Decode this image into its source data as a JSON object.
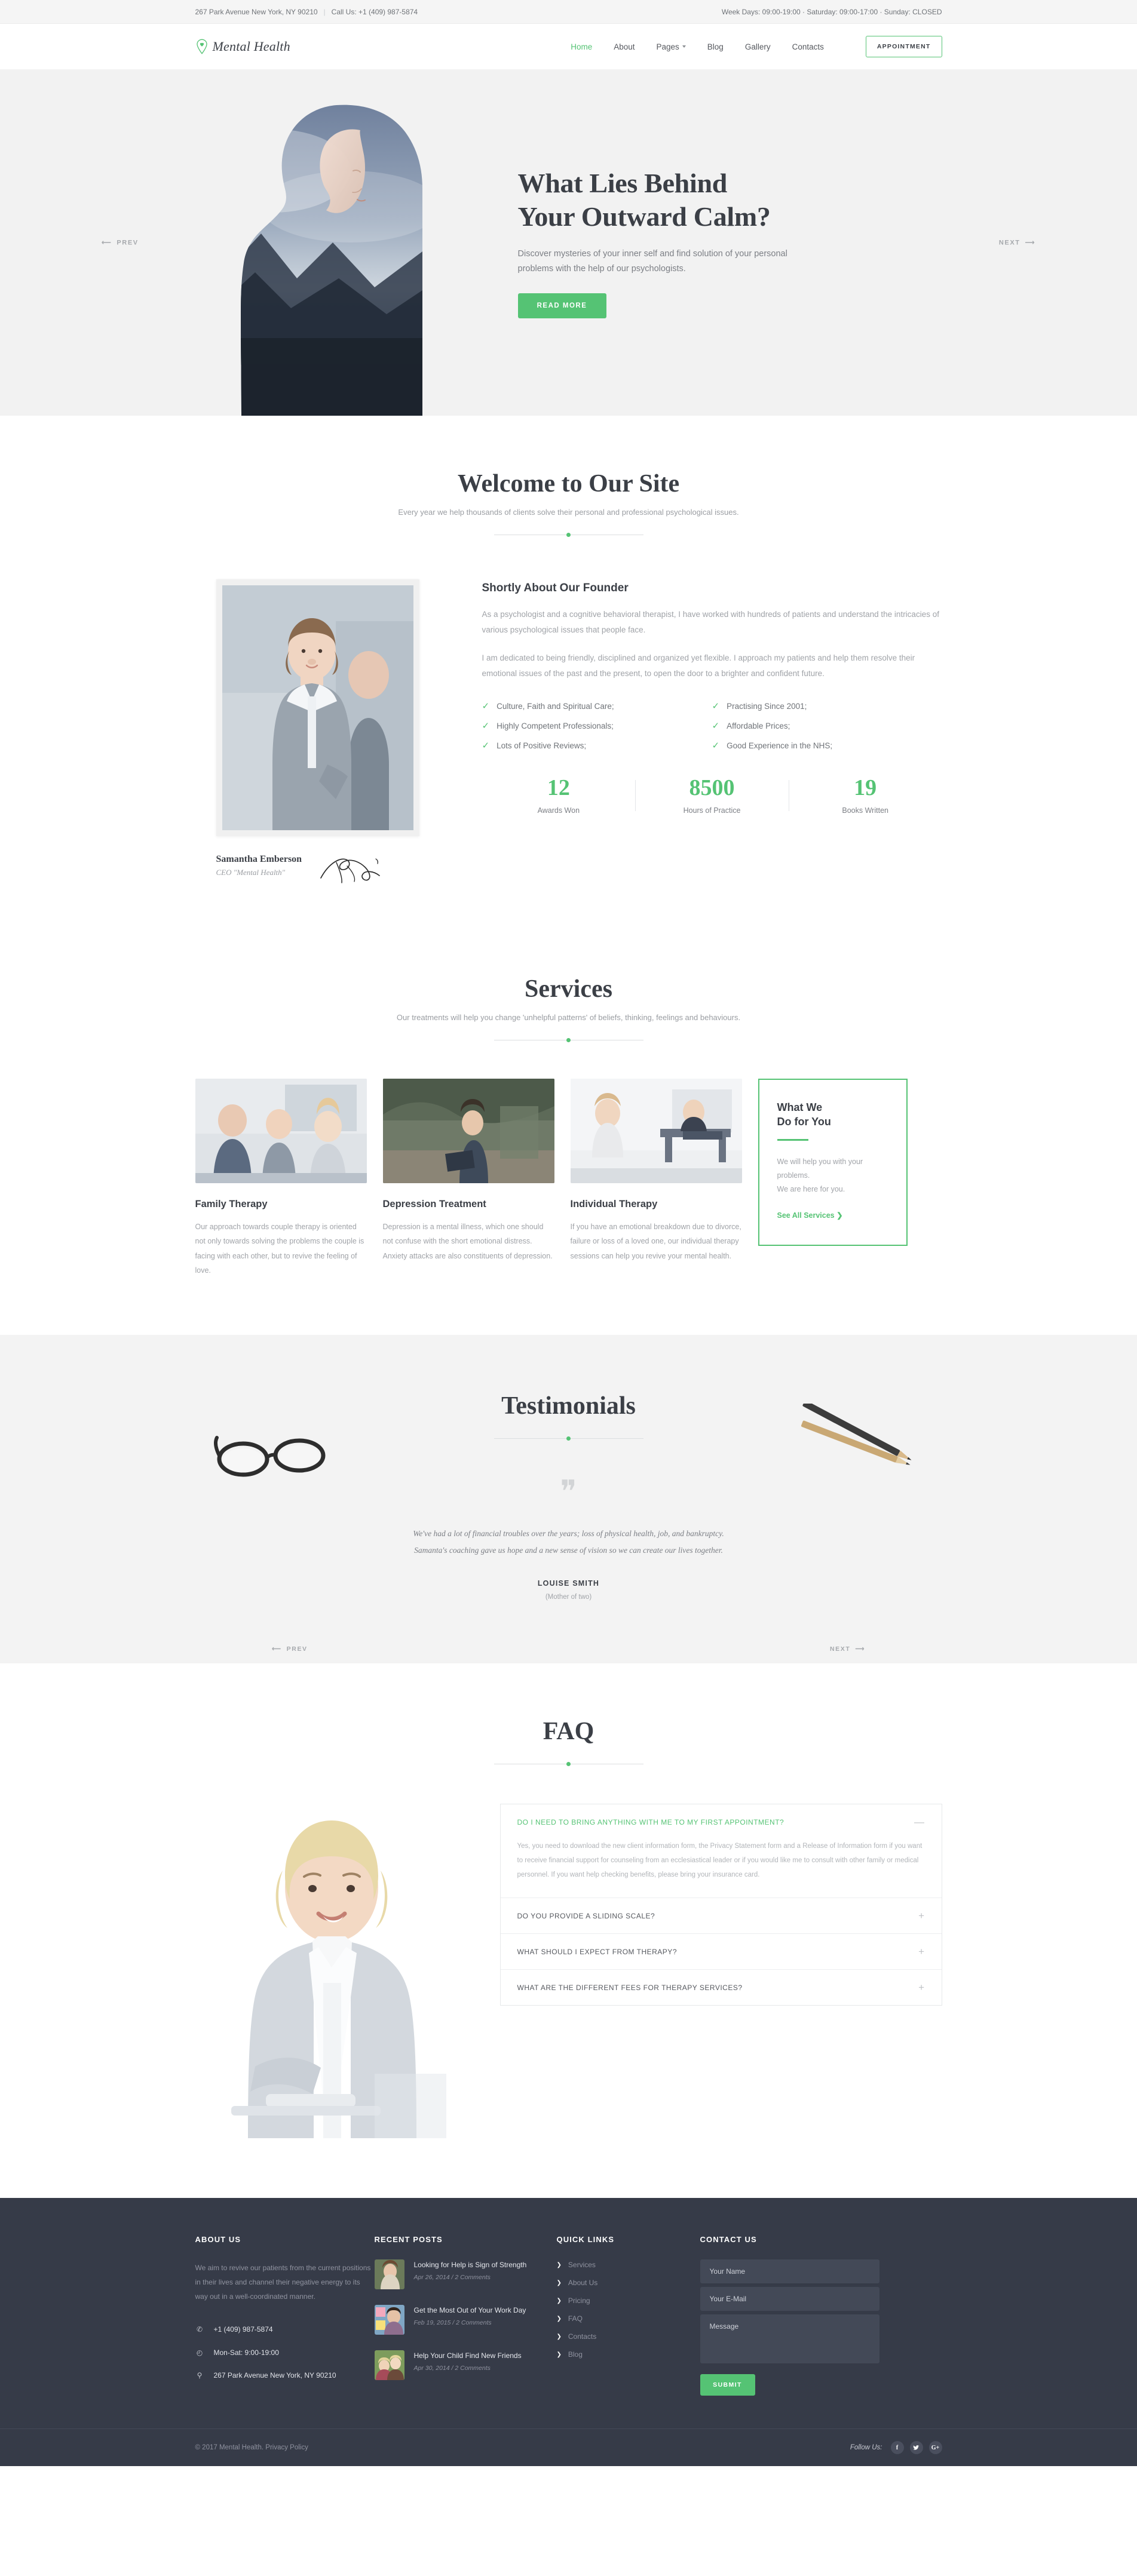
{
  "topbar": {
    "address": "267 Park Avenue New York, NY 90210",
    "separator": "|",
    "phone": "Call Us: +1 (409) 987-5874",
    "hours": "Week Days: 09:00-19:00 · Saturday: 09:00-17:00 · Sunday: CLOSED"
  },
  "header": {
    "logo_text": "Mental Health",
    "nav": [
      {
        "label": "Home",
        "active": true,
        "caret": false
      },
      {
        "label": "About",
        "active": false,
        "caret": false
      },
      {
        "label": "Pages",
        "active": false,
        "caret": true
      },
      {
        "label": "Blog",
        "active": false,
        "caret": false
      },
      {
        "label": "Gallery",
        "active": false,
        "caret": false
      },
      {
        "label": "Contacts",
        "active": false,
        "caret": false
      }
    ],
    "appointment_label": "APPOINTMENT"
  },
  "hero": {
    "title_line1": "What Lies Behind",
    "title_line2": "Your Outward Calm?",
    "subtitle": "Discover mysteries of your inner self and find solution of your personal problems with the help of our psychologists.",
    "button_label": "READ MORE",
    "prev_label": "PREV",
    "next_label": "NEXT"
  },
  "welcome": {
    "title": "Welcome to Our Site",
    "subtitle": "Every year we help thousands of clients solve their personal and professional psychological issues.",
    "founder": {
      "heading": "Shortly About Our Founder",
      "paragraph1": "As a psychologist and a cognitive behavioral therapist, I have worked with hundreds of patients and understand the intricacies of various psychological issues that people face.",
      "paragraph2": "I am dedicated to being friendly, disciplined and organized yet flexible. I approach my patients and help them resolve their emotional issues of the past and the present, to open the door to a brighter and confident future.",
      "name": "Samantha Emberson",
      "role": "CEO \"Mental Health\"",
      "checks": [
        "Culture, Faith and Spiritual Care;",
        "Practising Since 2001;",
        "Highly Competent Professionals;",
        "Affordable Prices;",
        "Lots of Positive Reviews;",
        "Good Experience in the NHS;"
      ]
    },
    "stats": [
      {
        "number": "12",
        "label": "Awards Won"
      },
      {
        "number": "8500",
        "label": "Hours of Practice"
      },
      {
        "number": "19",
        "label": "Books Written"
      }
    ]
  },
  "services": {
    "title": "Services",
    "subtitle": "Our treatments will help you change 'unhelpful patterns' of beliefs, thinking, feelings and behaviours.",
    "cards": [
      {
        "title": "Family Therapy",
        "text": "Our approach towards couple therapy is oriented not only towards solving the problems the couple is facing with each other, but to revive the feeling of love."
      },
      {
        "title": "Depression Treatment",
        "text": "Depression is a mental illness, which one should not confuse with the short emotional distress. Anxiety attacks are also constituents of depression."
      },
      {
        "title": "Individual Therapy",
        "text": "If you have an emotional breakdown due to divorce, failure or loss of a loved one, our individual therapy sessions can help you revive your mental health."
      }
    ],
    "cta": {
      "title_line1": "What We",
      "title_line2": "Do for You",
      "text_line1": "We will help you with your problems.",
      "text_line2": "We are here for you.",
      "link": "See All Services ❯"
    }
  },
  "testimonials": {
    "title": "Testimonials",
    "quote_glyph": "❞",
    "quote_line1": "We've had a lot of financial troubles over the years; loss of physical health, job, and bankruptcy.",
    "quote_line2": "Samanta's coaching gave us hope and a new sense of vision so we can create our lives together.",
    "author": "LOUISE SMITH",
    "author_role": "(Mother of two)",
    "prev_label": "PREV",
    "next_label": "NEXT"
  },
  "faq": {
    "title": "FAQ",
    "items": [
      {
        "question": "DO I NEED TO BRING ANYTHING WITH ME TO MY FIRST APPOINTMENT?",
        "sign": "—",
        "open": true,
        "answer": "Yes, you need to download the new client information form, the Privacy Statement form and a Release of Information form if you want to receive financial support for counseling from an ecclesiastical leader or if you would like me to consult with other family or medical personnel. If you want help checking benefits, please bring your insurance card."
      },
      {
        "question": "DO YOU PROVIDE A SLIDING SCALE?",
        "sign": "+",
        "open": false,
        "answer": ""
      },
      {
        "question": "WHAT SHOULD I EXPECT FROM THERAPY?",
        "sign": "+",
        "open": false,
        "answer": ""
      },
      {
        "question": "WHAT ARE THE DIFFERENT FEES FOR THERAPY SERVICES?",
        "sign": "+",
        "open": false,
        "answer": ""
      }
    ]
  },
  "footer": {
    "about": {
      "heading": "ABOUT US",
      "text": "We aim to revive our patients from the current positions in their lives and channel their negative energy to its way out in a well-coordinated manner.",
      "phone": "+1 (409) 987-5874",
      "hours": "Mon-Sat: 9:00-19:00",
      "address": "267 Park Avenue New York, NY 90210"
    },
    "posts": {
      "heading": "RECENT POSTS",
      "items": [
        {
          "title": "Looking for Help is Sign of Strength",
          "meta": "Apr 26, 2014 / 2 Comments"
        },
        {
          "title": "Get the Most Out of Your Work Day",
          "meta": "Feb 19, 2015 / 2 Comments"
        },
        {
          "title": "Help Your Child Find New Friends",
          "meta": "Apr 30, 2014 / 2 Comments"
        }
      ]
    },
    "links": {
      "heading": "QUICK LINKS",
      "items": [
        "Services",
        "About Us",
        "Pricing",
        "FAQ",
        "Contacts",
        "Blog"
      ]
    },
    "contact": {
      "heading": "CONTACT US",
      "name_placeholder": "Your Name",
      "email_placeholder": "Your E-Mail",
      "message_placeholder": "Message",
      "submit_label": "SUBMIT"
    },
    "bottom": {
      "copyright": "© 2017 Mental Health. Privacy Policy",
      "follow_label": "Follow Us:",
      "social": [
        "f",
        "🐦",
        "G+"
      ]
    }
  },
  "colors": {
    "accent": "#55c374",
    "dark": "#3b3f46",
    "footer_bg": "#363b48",
    "muted": "#a0a3a8"
  }
}
